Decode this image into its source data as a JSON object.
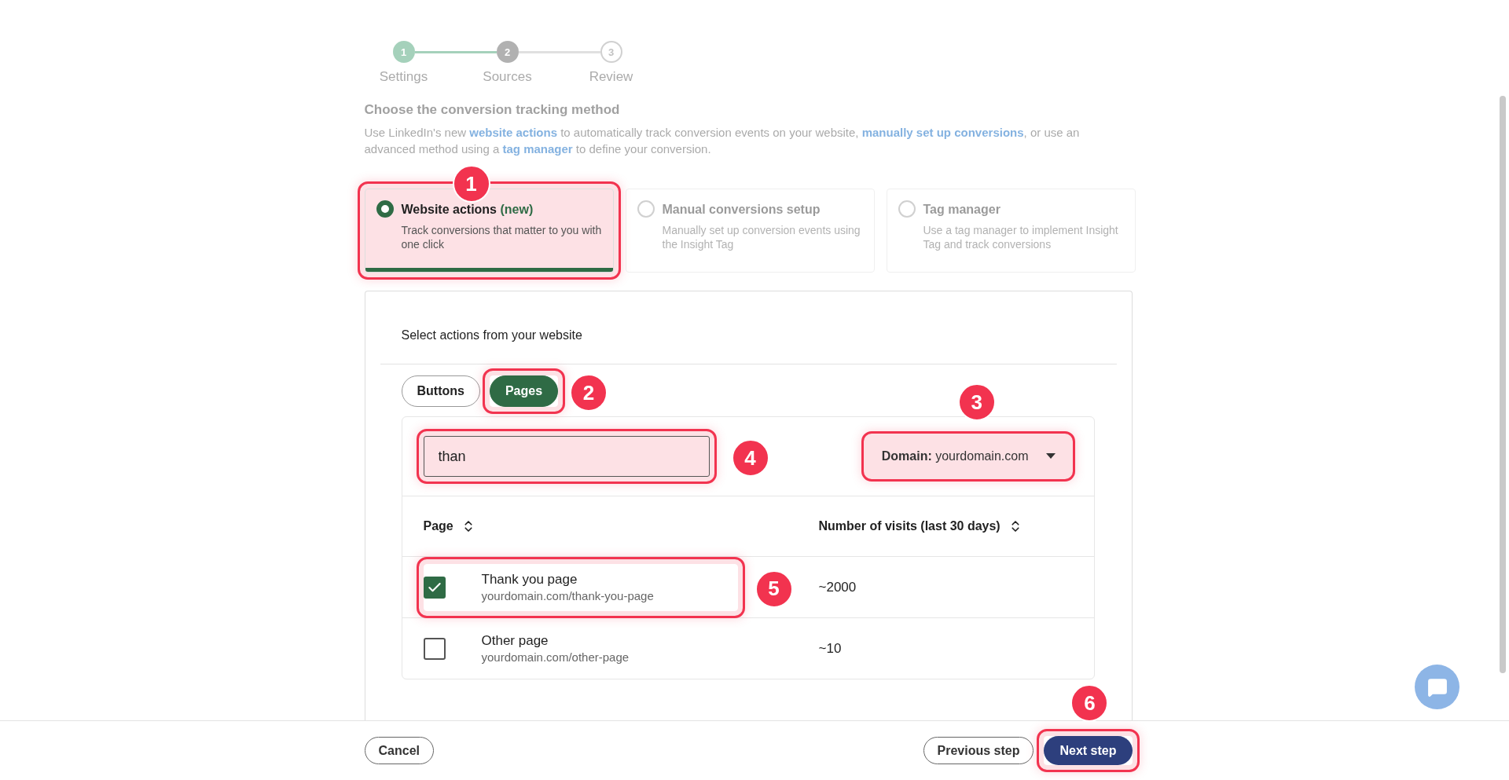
{
  "stepper": [
    {
      "number": "1",
      "label": "Settings",
      "kind": "complete"
    },
    {
      "number": "2",
      "label": "Sources",
      "kind": "current"
    },
    {
      "number": "3",
      "label": "Review",
      "kind": "upcoming"
    }
  ],
  "heading": "Choose the conversion tracking method",
  "description": [
    {
      "text": "Use LinkedIn's new ",
      "link": false
    },
    {
      "text": "website actions",
      "link": true
    },
    {
      "text": " to automatically track conversion events on your website, ",
      "link": false
    },
    {
      "text": "manually set up conversions",
      "link": true
    },
    {
      "text": ", or use an advanced method using a ",
      "link": false
    },
    {
      "text": "tag manager",
      "link": true
    },
    {
      "text": " to define your conversion.",
      "link": false
    }
  ],
  "methods": [
    {
      "title": "Website actions",
      "tag": "(new)",
      "description": "Track conversions that matter to you with one click",
      "selected": true,
      "badge": "1"
    },
    {
      "title": "Manual conversions setup",
      "description": "Manually set up conversion events using the Insight Tag",
      "selected": false
    },
    {
      "title": "Tag manager",
      "description": "Use a tag manager to implement Insight Tag and track conversions",
      "selected": false
    }
  ],
  "panel": {
    "title": "Select actions from your website",
    "toggles": [
      {
        "label": "Buttons",
        "selected": false
      },
      {
        "label": "Pages",
        "selected": true,
        "badge": "2"
      }
    ],
    "search": {
      "value": "than",
      "badge": "4"
    },
    "domain": {
      "label": "Domain:",
      "value": "yourdomain.com",
      "badge": "3"
    },
    "columns": [
      "Page",
      "Number of visits (last 30 days)"
    ],
    "rows": [
      {
        "checked": true,
        "name": "Thank you page",
        "url": "yourdomain.com/thank-you-page",
        "visits": "~2000",
        "badge": "5"
      },
      {
        "checked": false,
        "name": "Other page",
        "url": "yourdomain.com/other-page",
        "visits": "~10"
      }
    ]
  },
  "footer": {
    "cancel": "Cancel",
    "previous": "Previous step",
    "next": {
      "label": "Next step",
      "badge": "6"
    }
  }
}
